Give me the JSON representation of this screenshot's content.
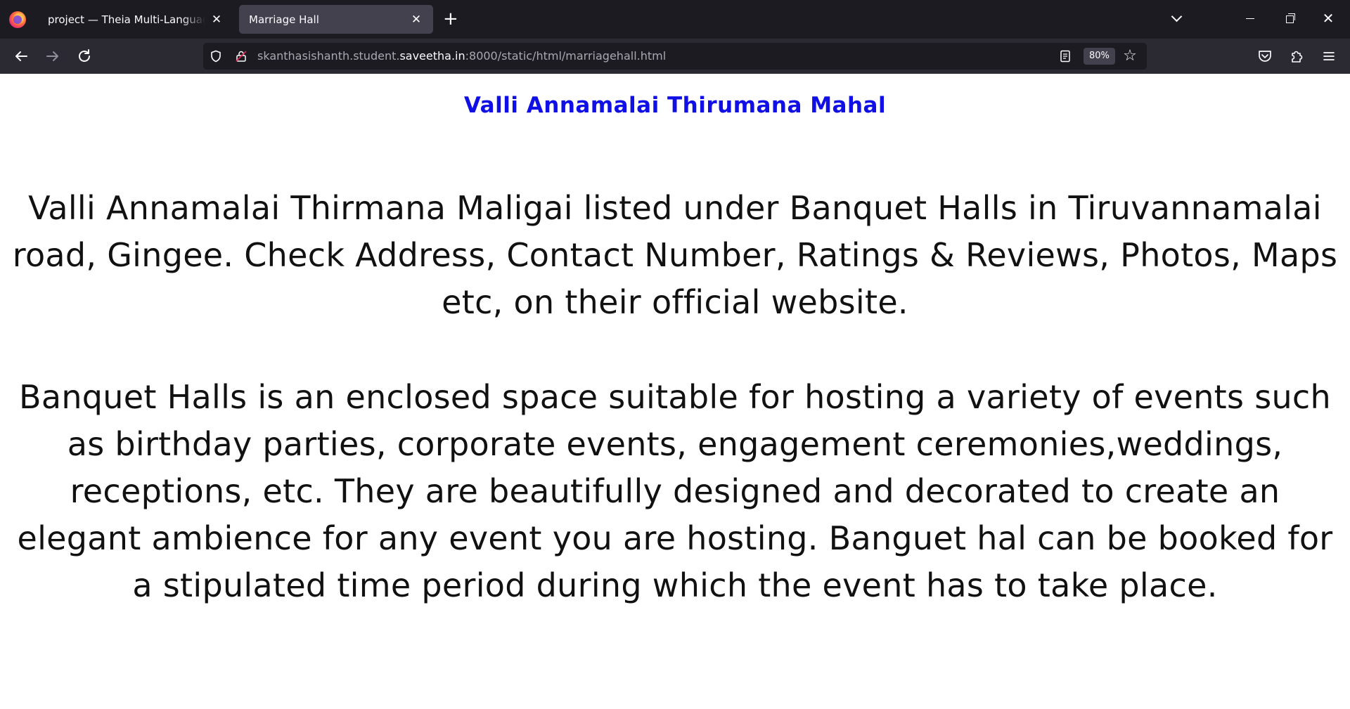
{
  "browser": {
    "tabs": [
      {
        "label": "project — Theia Multi-Language Ex",
        "active": false
      },
      {
        "label": "Marriage Hall",
        "active": true
      }
    ],
    "url": {
      "prefix": "skanthasishanth.student.",
      "host": "saveetha.in",
      "suffix": ":8000/static/html/marriagehall.html"
    },
    "zoom": "80%",
    "theme": {
      "tabbar": "#1c1b22",
      "navbar": "#2b2a33",
      "active_tab": "#42414d"
    }
  },
  "page": {
    "title": "Valli Annamalai Thirumana Mahal",
    "title_color": "#1010e6",
    "paragraph1": "Valli Annamalai Thirmana Maligai listed under Banquet Halls in Tiruvannamalai road, Gingee. Check Address, Contact Number, Ratings & Reviews, Photos, Maps etc, on their official website.",
    "paragraph2": "Banquet Halls is an enclosed space suitable for hosting a variety of events such as birthday parties, corporate events, engagement ceremonies,weddings, receptions, etc. They are beautifully designed and decorated to create an elegant ambience for any event you are hosting. Banguet hal can be booked for a stipulated time period during which the event has to take place."
  }
}
